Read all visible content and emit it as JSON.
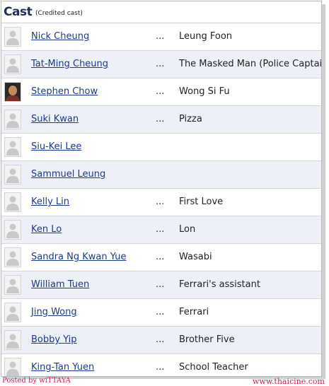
{
  "header": {
    "title": "Cast",
    "subtitle": "(Credited cast)"
  },
  "dots": "...",
  "cast": [
    {
      "name": "Nick Cheung",
      "role": "Leung Foon",
      "photo": "placeholder-avatar-icon"
    },
    {
      "name": "Tat-Ming Cheung",
      "role": "The Masked Man (Police Captain)",
      "photo": "placeholder-avatar-icon"
    },
    {
      "name": "Stephen Chow",
      "role": "Wong Si Fu",
      "photo": "actor-photo"
    },
    {
      "name": "Suki Kwan",
      "role": "Pizza",
      "photo": "placeholder-avatar-icon"
    },
    {
      "name": "Siu-Kei Lee",
      "role": "",
      "photo": "placeholder-avatar-icon"
    },
    {
      "name": "Sammuel Leung",
      "role": "",
      "photo": "placeholder-avatar-icon"
    },
    {
      "name": "Kelly Lin",
      "role": "First Love",
      "photo": "placeholder-avatar-icon"
    },
    {
      "name": "Ken Lo",
      "role": "Lon",
      "photo": "placeholder-avatar-icon"
    },
    {
      "name": "Sandra Ng Kwan Yue",
      "role": "Wasabi",
      "photo": "placeholder-avatar-icon"
    },
    {
      "name": "William Tuen",
      "role": "Ferrari's assistant",
      "photo": "placeholder-avatar-icon"
    },
    {
      "name": "Jing Wong",
      "role": "Ferrari",
      "photo": "placeholder-avatar-icon"
    },
    {
      "name": "Bobby Yip",
      "role": "Brother Five",
      "photo": "placeholder-avatar-icon"
    },
    {
      "name": "King-Tan Yuen",
      "role": "School Teacher",
      "photo": "placeholder-avatar-icon"
    }
  ],
  "footer": {
    "left": "Posted by wiTTAYA",
    "right": "www.thaicine.com"
  },
  "colors": {
    "link": "#1d3a8a",
    "title": "#1f2f56",
    "stripe": "#eef0f8",
    "watermark": "#d21c5a"
  }
}
